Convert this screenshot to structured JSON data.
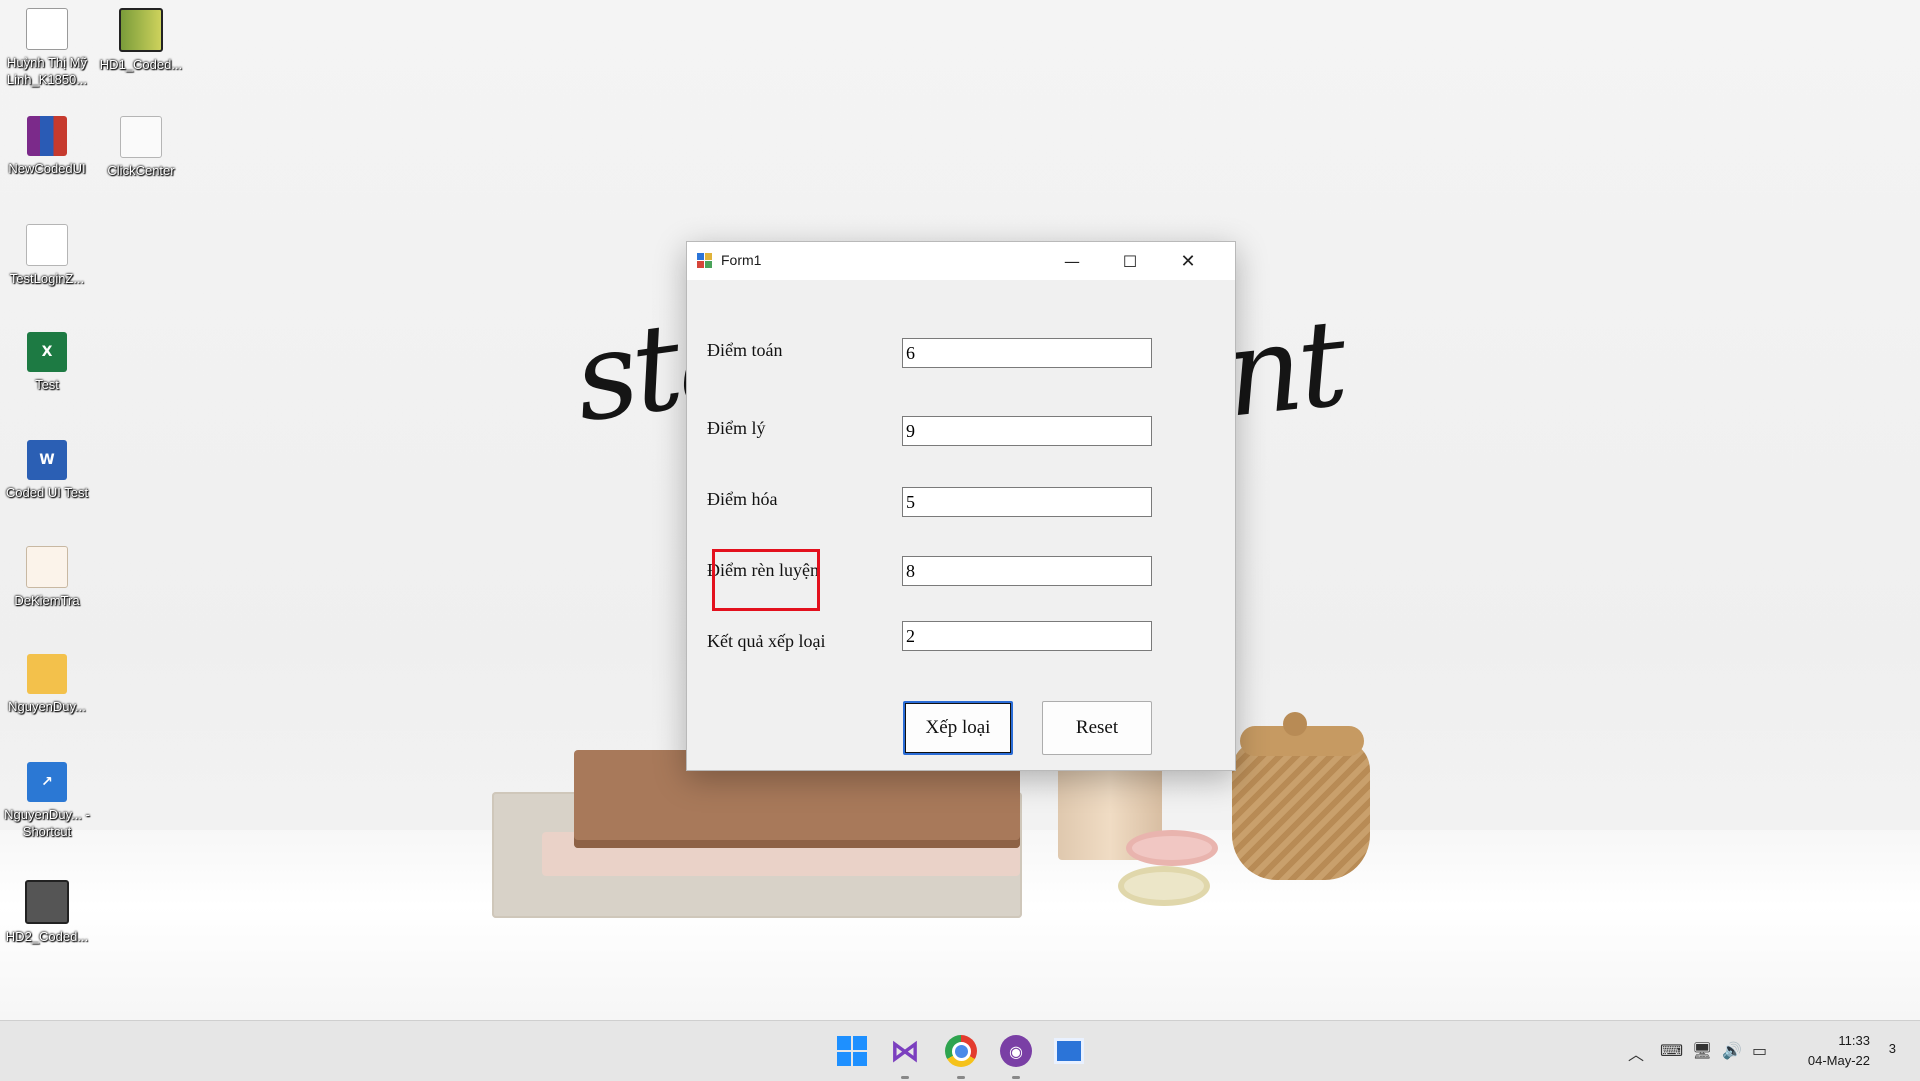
{
  "desktop": {
    "wallpaper_script_left": "stay",
    "wallpaper_script_right": "nt",
    "icons": [
      {
        "label": "Huỳnh Thị Mỹ Linh_K1850...",
        "icon": "document-icon"
      },
      {
        "label": "HD1_Coded...",
        "icon": "video-icon"
      },
      {
        "label": "NewCodedUI",
        "icon": "winrar-icon"
      },
      {
        "label": "ClickCenter",
        "icon": "text-file-icon"
      },
      {
        "label": "TestLoginZ...",
        "icon": "blank-file-icon"
      },
      {
        "label": "Test",
        "icon": "excel-icon"
      },
      {
        "label": "Coded UI Test",
        "icon": "word-icon"
      },
      {
        "label": "DeKiemTra",
        "icon": "document-icon"
      },
      {
        "label": "NguyenDuy...",
        "icon": "folder-icon"
      },
      {
        "label": "NguyenDuy... - Shortcut",
        "icon": "shortcut-icon"
      },
      {
        "label": "HD2_Coded...",
        "icon": "video-icon"
      }
    ]
  },
  "window": {
    "title": "Form1",
    "fields": [
      {
        "label": "Điểm toán",
        "value": "6"
      },
      {
        "label": "Điểm lý",
        "value": "9"
      },
      {
        "label": "Điểm hóa",
        "value": "5"
      },
      {
        "label": "Điểm rèn luyện",
        "value": "8"
      },
      {
        "label": "Kết quả xếp loại",
        "value": "2"
      }
    ],
    "buttons": {
      "classify": "Xếp loại",
      "reset": "Reset"
    }
  },
  "taskbar": {
    "apps": [
      "windows-start-icon",
      "visual-studio-icon",
      "chrome-icon",
      "github-desktop-icon",
      "winforms-app-icon"
    ],
    "time": "11:33",
    "date": "04-May-22",
    "notification_count": "3"
  },
  "colors": {
    "highlight_box": "#e3101d",
    "focus_border": "#2a6cd6"
  }
}
